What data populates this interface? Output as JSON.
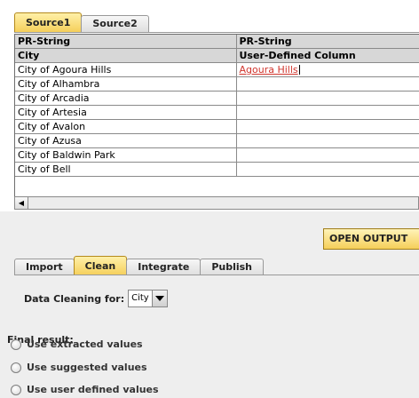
{
  "source_tabs": [
    {
      "label": "Source1",
      "active": true
    },
    {
      "label": "Source2",
      "active": false
    }
  ],
  "table": {
    "type_headers": [
      "PR-String",
      "PR-String"
    ],
    "column_headers": [
      "City",
      "User-Defined Column"
    ],
    "rows": [
      [
        "City of Agoura Hills",
        "Agoura Hills"
      ],
      [
        "City of Alhambra",
        ""
      ],
      [
        "City of Arcadia",
        ""
      ],
      [
        "City of Artesia",
        ""
      ],
      [
        "City of Avalon",
        ""
      ],
      [
        "City of Azusa",
        ""
      ],
      [
        "City of Baldwin Park",
        ""
      ],
      [
        "City of Bell",
        ""
      ]
    ]
  },
  "buttons": {
    "open_output": "OPEN OUTPUT"
  },
  "bottom_tabs": [
    {
      "label": "Import",
      "active": false
    },
    {
      "label": "Clean",
      "active": true
    },
    {
      "label": "Integrate",
      "active": false
    },
    {
      "label": "Publish",
      "active": false
    }
  ],
  "cleaning": {
    "label": "Data Cleaning for:",
    "selected_column": "City",
    "final_result_label": "Final result:",
    "options": [
      "Use extracted values",
      "Use suggested values",
      "Use user defined values"
    ]
  }
}
